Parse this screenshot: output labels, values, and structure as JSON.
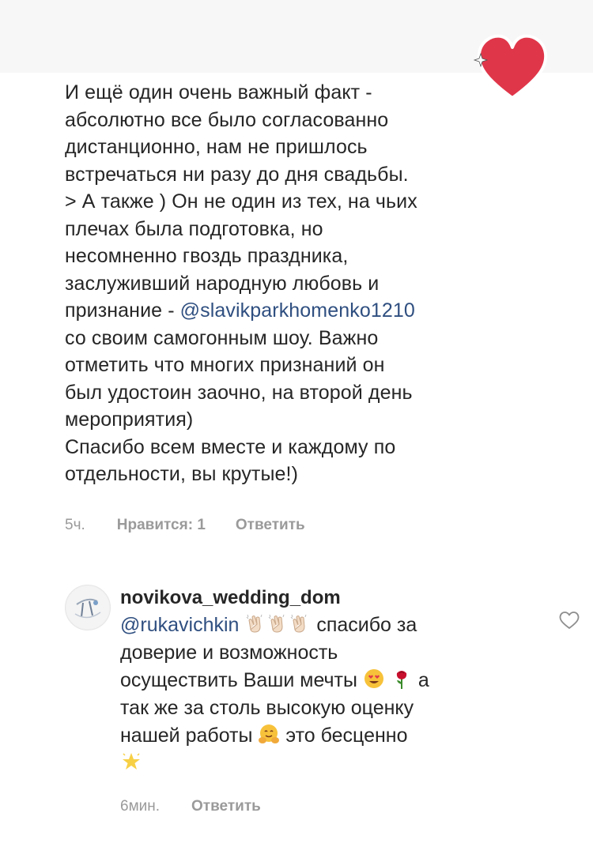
{
  "comment1": {
    "paragraph1": "И ещё один очень важный факт -\nабсолютно все было согласованно\nдистанционно, нам не пришлось\nвстречаться ни разу до дня свадьбы.",
    "paragraph2_part1": "> А также ) Он не один из тех, на чьих\nплечах была подготовка, но\nнесомненно гвоздь праздника,\nзаслуживший народную любовь и\nпризнание - ",
    "mention": "@slavikparkhomenko1210",
    "paragraph2_part2": "\nсо своим самогонным шоу. Важно\nотметить что многих признаний он\nбыл удостоин заочно, на второй день\nмероприятия)",
    "paragraph3": "Спасибо всем вместе и каждому по\nотдельности, вы крутые!)",
    "time": "5ч.",
    "likes": "Нравится: 1",
    "reply": "Ответить"
  },
  "comment2": {
    "username": "novikova_wedding_dom",
    "mention": "@rukavichkin",
    "text_part1": " спасибо за\nдоверие и возможность\nосуществить Ваши мечты ",
    "text_part2": " а\nтак же за столь высокую оценку\nнашей работы ",
    "text_part3": " это бесценно",
    "time": "6мин.",
    "reply": "Ответить"
  },
  "colors": {
    "heart": "#e0364a",
    "mention": "#2f4f80",
    "meta": "#9a9a9a"
  },
  "icons": {
    "reaction": "heart-icon",
    "like": "heart-outline-icon"
  }
}
